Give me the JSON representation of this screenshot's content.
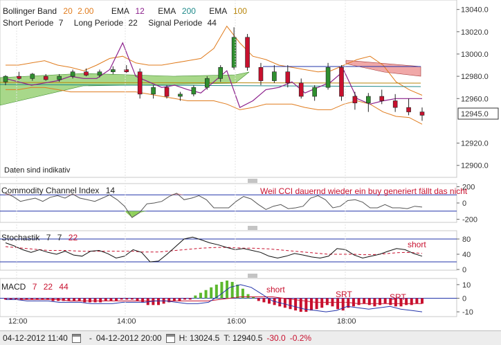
{
  "header": {
    "bollinger": {
      "label": "Bollinger Band",
      "p1": "20",
      "p2": "2.00"
    },
    "ema1": {
      "label": "EMA",
      "value": "12"
    },
    "ema2": {
      "label": "EMA",
      "value": "200"
    },
    "ema3": {
      "label": "EMA",
      "value": "100"
    },
    "ichimoku": {
      "short_label": "Short Periode",
      "short_value": "7",
      "long_label": "Long Periode",
      "long_value": "22",
      "signal_label": "Signal Periode",
      "signal_value": "44"
    }
  },
  "notice": "Daten sind indikativ",
  "panels": {
    "cci": {
      "label": "Commodity Channel Index",
      "period": "14",
      "annotation": "Weil CCI dauernd wieder ein buy generiert fällt das nicht"
    },
    "stoch": {
      "label": "Stochastik",
      "k": "7",
      "d": "7",
      "smooth": "22",
      "annotation": "short"
    },
    "macd": {
      "label": "MACD",
      "fast": "7",
      "slow": "22",
      "signal": "44",
      "annotations": [
        "short",
        "SRT",
        "SRT"
      ]
    }
  },
  "colors": {
    "candle_up": "#2f8f2f",
    "candle_down": "#c8102e",
    "bollinger": "#e07b1c",
    "ema12": "#8b1f8b",
    "ema200": "#1f8a8a",
    "ema100": "#b8860b",
    "cloud_green": "#a8d88a",
    "cloud_red": "#f0a8a8",
    "cci_pos": "#e8a0a0",
    "cci_neg": "#8fd05a",
    "macd_pos": "#5cb82e",
    "macd_neg": "#c8102e"
  },
  "statusbar": {
    "start": "04-12-2012 11:40",
    "end": "04-12-2012 20:00",
    "high": "H: 13024.5",
    "low": "T: 12940.5",
    "change": "-30.0",
    "change_pct": "-0.2%"
  },
  "chart_data": [
    {
      "type": "candlestick",
      "title": "",
      "x_ticks": [
        "12:00",
        "14:00",
        "16:00",
        "18:00"
      ],
      "y_ticks": [
        13040,
        13020,
        13000,
        12980,
        12960,
        12920,
        12900
      ],
      "ylim": [
        12893,
        13046
      ],
      "last_price": "12945.0",
      "series": [
        {
          "name": "Bollinger Band",
          "upper": [
            12990,
            12990,
            12992,
            12994,
            12990,
            12988,
            12985,
            12990,
            12996,
            12998,
            12992,
            12990,
            12990,
            12992,
            12994,
            12996,
            13005,
            13025,
            13010,
            12998,
            12995,
            12990,
            12988,
            12986,
            12984,
            12985,
            12990,
            12995,
            12998,
            12990,
            12975,
            12968,
            12963
          ],
          "lower": [
            12968,
            12968,
            12970,
            12970,
            12968,
            12966,
            12966,
            12966,
            12966,
            12966,
            12966,
            12964,
            12962,
            12960,
            12958,
            12958,
            12958,
            12955,
            12950,
            12952,
            12955,
            12955,
            12955,
            12952,
            12950,
            12950,
            12955,
            12958,
            12955,
            12948,
            12944,
            12943,
            12937
          ]
        },
        {
          "name": "EMA 12",
          "values": [
            12978,
            12975,
            12972,
            12974,
            12976,
            12980,
            12978,
            12978,
            12986,
            13010,
            12980,
            12975,
            12970,
            12972,
            12968,
            12965,
            12975,
            12985,
            12952,
            12958,
            12968,
            12970,
            12975,
            12965,
            12970,
            12975,
            12985,
            12960,
            12955,
            12958,
            12960,
            12960,
            12960
          ]
        }
      ],
      "candles": [
        [
          12975,
          12981,
          12972,
          12980
        ],
        [
          12980,
          12984,
          12977,
          12978
        ],
        [
          12978,
          12983,
          12976,
          12982
        ],
        [
          12980,
          12982,
          12976,
          12977
        ],
        [
          12977,
          12982,
          12975,
          12980
        ],
        [
          12980,
          12986,
          12978,
          12984
        ],
        [
          12984,
          12987,
          12980,
          12981
        ],
        [
          12981,
          12986,
          12979,
          12984
        ],
        [
          12984,
          12989,
          12982,
          12986
        ],
        [
          12986,
          12990,
          12983,
          12984
        ],
        [
          12984,
          12987,
          12960,
          12964
        ],
        [
          12964,
          12972,
          12960,
          12970
        ],
        [
          12970,
          12972,
          12960,
          12962
        ],
        [
          12962,
          12966,
          12958,
          12964
        ],
        [
          12964,
          12972,
          12962,
          12970
        ],
        [
          12970,
          12980,
          12968,
          12978
        ],
        [
          12978,
          12990,
          12975,
          12988
        ],
        [
          12988,
          13024,
          12986,
          13015
        ],
        [
          13015,
          13018,
          12985,
          12988
        ],
        [
          12988,
          12992,
          12972,
          12976
        ],
        [
          12976,
          12990,
          12974,
          12984
        ],
        [
          12984,
          12990,
          12970,
          12974
        ],
        [
          12974,
          12978,
          12960,
          12962
        ],
        [
          12962,
          12972,
          12958,
          12970
        ],
        [
          12970,
          12992,
          12968,
          12988
        ],
        [
          12988,
          12990,
          12958,
          12962
        ],
        [
          12962,
          12966,
          12950,
          12956
        ],
        [
          12956,
          12965,
          12948,
          12962
        ],
        [
          12962,
          12968,
          12955,
          12958
        ],
        [
          12958,
          12964,
          12948,
          12952
        ],
        [
          12952,
          12960,
          12945,
          12948
        ],
        [
          12948,
          12952,
          12940,
          12945
        ]
      ]
    },
    {
      "type": "line",
      "title": "Commodity Channel Index 14",
      "y_ticks": [
        200,
        0,
        -200
      ],
      "ylim": [
        -230,
        230
      ],
      "values": [
        120,
        80,
        20,
        40,
        60,
        20,
        70,
        90,
        60,
        110,
        60,
        40,
        20,
        60,
        100,
        40,
        -40,
        -180,
        -120,
        -10,
        0,
        20,
        80,
        120,
        40,
        60,
        90,
        40,
        -60,
        -60,
        -60,
        20,
        80,
        50,
        -20,
        -80,
        -40,
        -20,
        -70,
        -60,
        -40,
        60,
        90,
        40,
        -60,
        -40,
        30,
        40,
        10,
        -60,
        -60,
        -20,
        -60,
        -60,
        -70,
        -40,
        -50
      ]
    },
    {
      "type": "line",
      "title": "Stochastik 7 7 22",
      "y_ticks": [
        80,
        40,
        0
      ],
      "ylim": [
        0,
        100
      ],
      "series": [
        {
          "name": "%K",
          "values": [
            70,
            62,
            52,
            45,
            52,
            45,
            40,
            48,
            38,
            35,
            48,
            50,
            42,
            30,
            35,
            52,
            45,
            20,
            22,
            40,
            60,
            80,
            85,
            78,
            70,
            65,
            58,
            52,
            55,
            50,
            45,
            35,
            30,
            35,
            42,
            38,
            33,
            30,
            35,
            55,
            52,
            38,
            30,
            35,
            40,
            48,
            55,
            52,
            42,
            35
          ]
        },
        {
          "name": "%D",
          "values": [
            60,
            58,
            56,
            54,
            52,
            50,
            50,
            50,
            49,
            48,
            48,
            48,
            48,
            48,
            48,
            48,
            46,
            46,
            46,
            48,
            50,
            52,
            54,
            56,
            57,
            58,
            58,
            57,
            56,
            56,
            55,
            54,
            52,
            50,
            48,
            46,
            44,
            42,
            40,
            40,
            40,
            40,
            39,
            39,
            40,
            42,
            44,
            45,
            44,
            42
          ]
        }
      ]
    },
    {
      "type": "bar",
      "title": "MACD 7 22 44",
      "y_ticks": [
        10,
        0,
        -10
      ],
      "ylim": [
        -13,
        14
      ],
      "values": [
        -1,
        -1,
        -1,
        -1,
        -1,
        -1,
        -1,
        -1,
        -1,
        -2,
        -2,
        -2,
        -2,
        -2,
        -2,
        -3,
        -3,
        -3,
        -3,
        -2,
        -2,
        -2,
        -1,
        -1,
        -1,
        -2,
        -3,
        -5,
        -5,
        -5,
        -4,
        -3,
        -2,
        -2,
        -1,
        -1,
        2,
        4,
        6,
        8,
        10,
        12,
        13,
        12,
        10,
        7,
        3,
        1,
        -2,
        -3,
        -4,
        -5,
        -6,
        -7,
        -8,
        -9,
        -10,
        -10,
        -9,
        -8,
        -7,
        -5,
        -6,
        -8,
        -9,
        -7,
        -6,
        -5,
        -4,
        -5,
        -6,
        -5,
        -4,
        -5,
        -6,
        -6,
        -5,
        -5,
        -4,
        -4
      ],
      "series": [
        {
          "name": "MACD",
          "values": [
            -1,
            -1,
            -2,
            -2,
            -2,
            -3,
            -3,
            -3,
            -4,
            -4,
            -4,
            -3,
            -3,
            -3,
            -2,
            -2,
            -3,
            -4,
            -4,
            -3,
            2,
            8,
            10,
            8,
            3,
            -2,
            -4,
            -6,
            -8,
            -9,
            -10,
            -9,
            -6,
            -7,
            -8,
            -7,
            -6,
            -8,
            -9,
            -10
          ]
        },
        {
          "name": "Signal",
          "values": [
            -1,
            -1,
            -1,
            -1,
            -1,
            -1,
            -2,
            -2,
            -2,
            -2,
            -2,
            -2,
            -2,
            -2,
            -2,
            -2,
            -2,
            -2,
            -2,
            -2,
            -1,
            0,
            1,
            1,
            1,
            1,
            0,
            -1,
            -2,
            -3,
            -3,
            -3,
            -3,
            -4,
            -4,
            -4,
            -4,
            -4,
            -4,
            -4
          ]
        }
      ]
    }
  ]
}
